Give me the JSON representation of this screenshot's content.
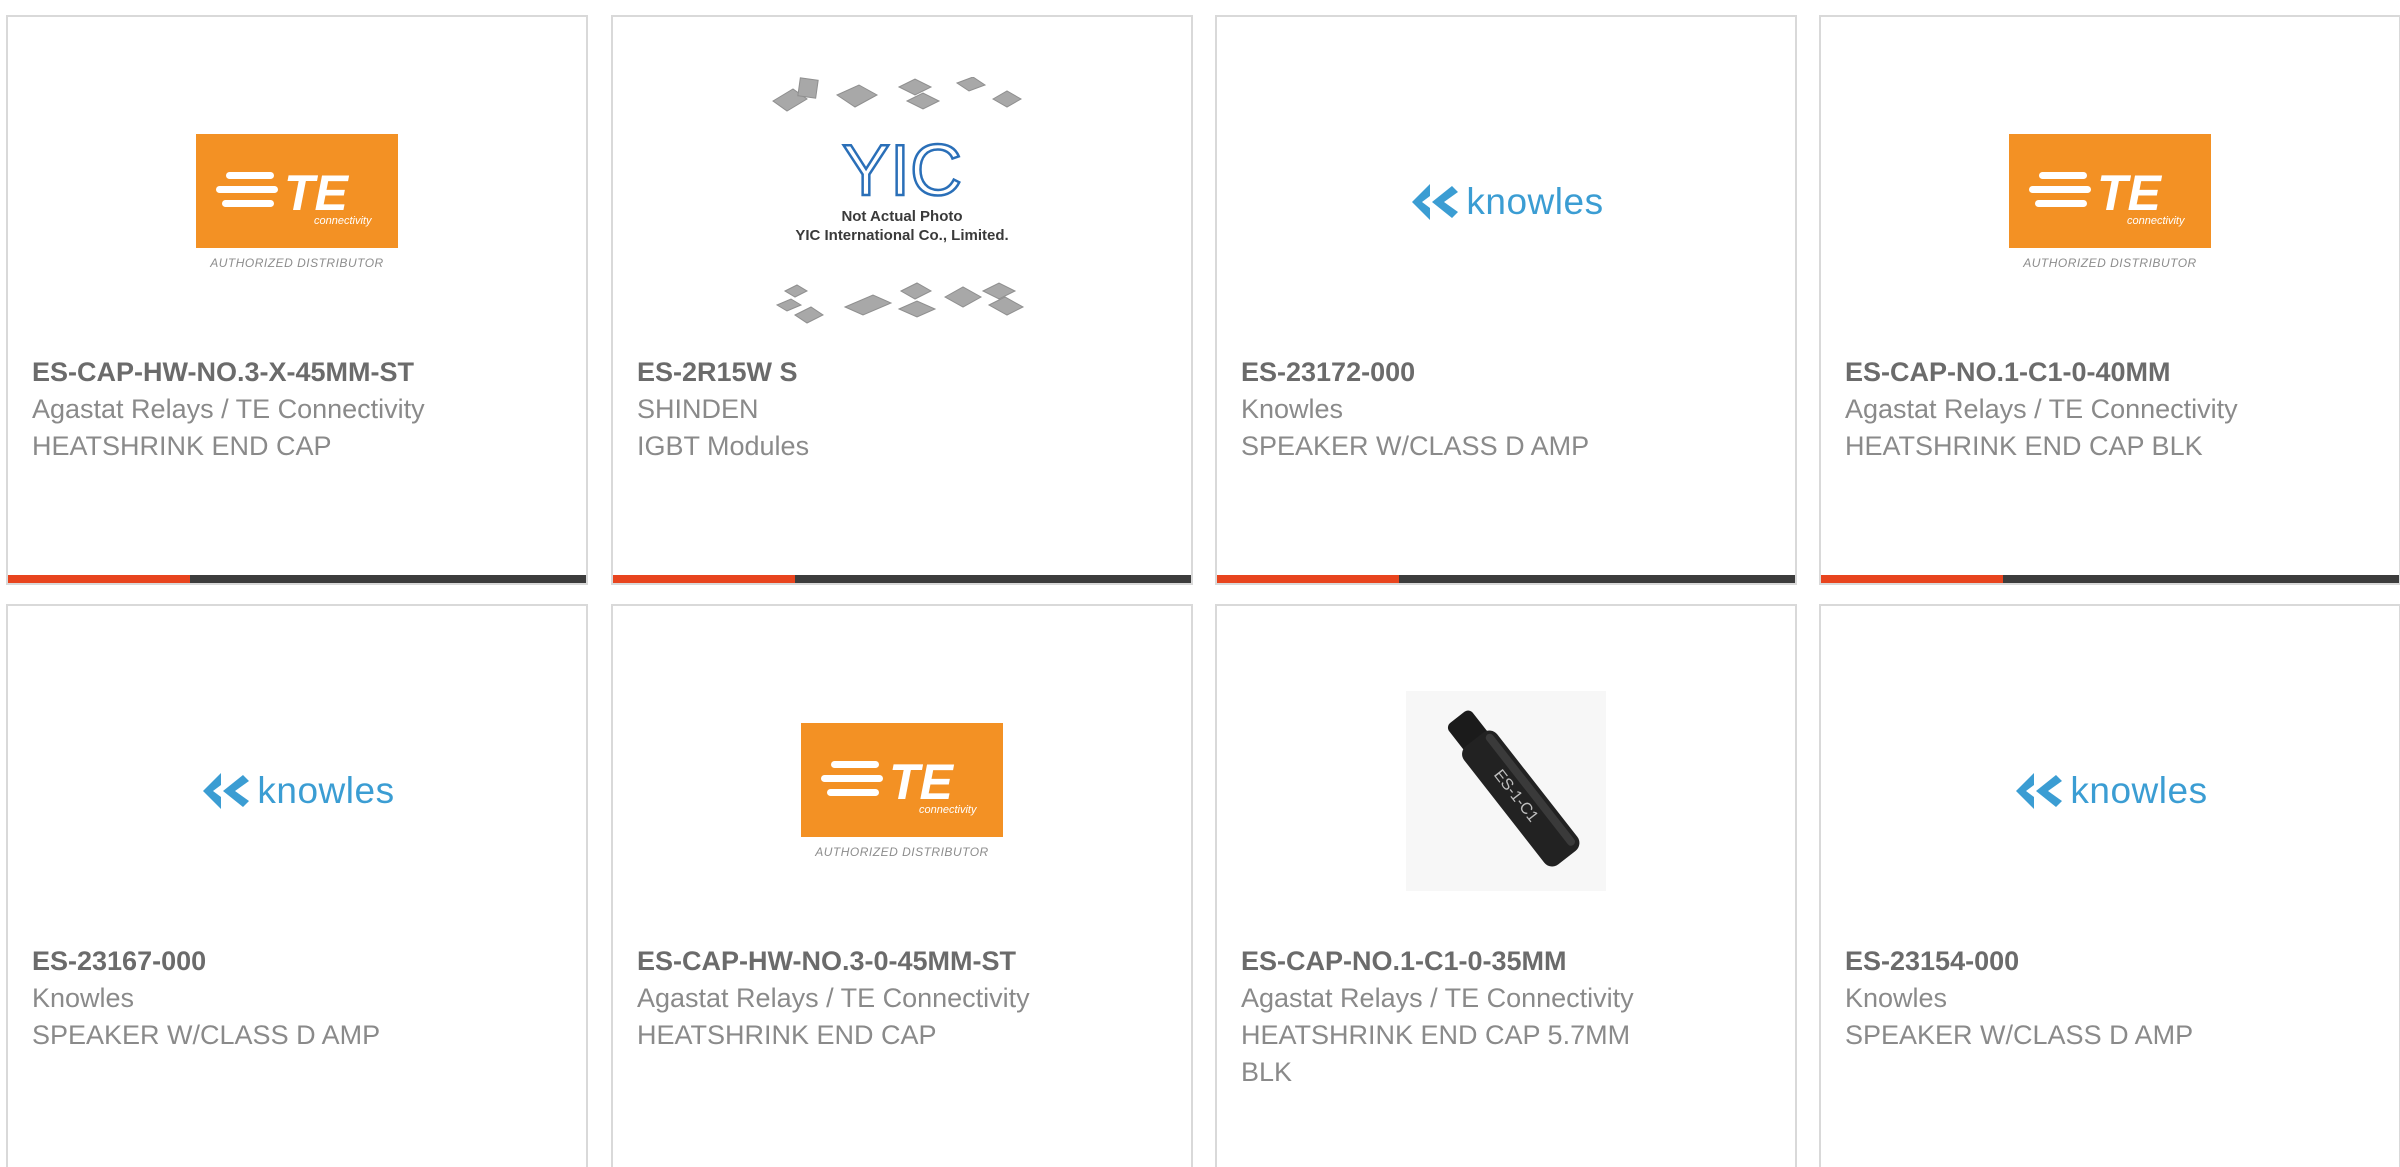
{
  "products": [
    {
      "part": "ES-CAP-HW-NO.3-X-45MM-ST",
      "maker": "Agastat Relays / TE Connectivity",
      "desc": "HEATSHRINK END CAP",
      "image": "te-connectivity-logo",
      "has_bar": true
    },
    {
      "part": "ES-2R15W S",
      "maker": "SHINDEN",
      "desc": "IGBT Modules",
      "image": "yic-placeholder",
      "has_bar": true
    },
    {
      "part": "ES-23172-000",
      "maker": "Knowles",
      "desc": "SPEAKER W/CLASS D AMP",
      "image": "knowles-logo",
      "has_bar": true
    },
    {
      "part": "ES-CAP-NO.1-C1-0-40MM",
      "maker": "Agastat Relays / TE Connectivity",
      "desc": "HEATSHRINK END CAP BLK",
      "image": "te-connectivity-logo",
      "has_bar": true
    },
    {
      "part": "ES-23167-000",
      "maker": "Knowles",
      "desc": "SPEAKER W/CLASS D AMP",
      "image": "knowles-logo",
      "has_bar": false
    },
    {
      "part": "ES-CAP-HW-NO.3-0-45MM-ST",
      "maker": "Agastat Relays / TE Connectivity",
      "desc": "HEATSHRINK END CAP",
      "image": "te-connectivity-logo",
      "has_bar": false
    },
    {
      "part": "ES-CAP-NO.1-C1-0-35MM",
      "maker": "Agastat Relays / TE Connectivity",
      "desc": "HEATSHRINK END CAP 5.7MM BLK",
      "image": "end-cap-photo",
      "has_bar": false
    },
    {
      "part": "ES-23154-000",
      "maker": "Knowles",
      "desc": "SPEAKER W/CLASS D AMP",
      "image": "knowles-logo",
      "has_bar": false
    }
  ],
  "logos": {
    "te_brand": "TE",
    "te_sub": "connectivity",
    "te_authorized": "AUTHORIZED DISTRIBUTOR",
    "knowles_text": "knowles",
    "yic_brand": "YIC",
    "yic_line1": "Not Actual Photo",
    "yic_line2": "YIC International Co., Limited.",
    "cap_label": "ES-1-C1"
  },
  "colors": {
    "accent": "#e8441e",
    "bar": "#3c3c3c",
    "te_orange": "#f39124",
    "knowles_blue": "#3b9dd3"
  }
}
